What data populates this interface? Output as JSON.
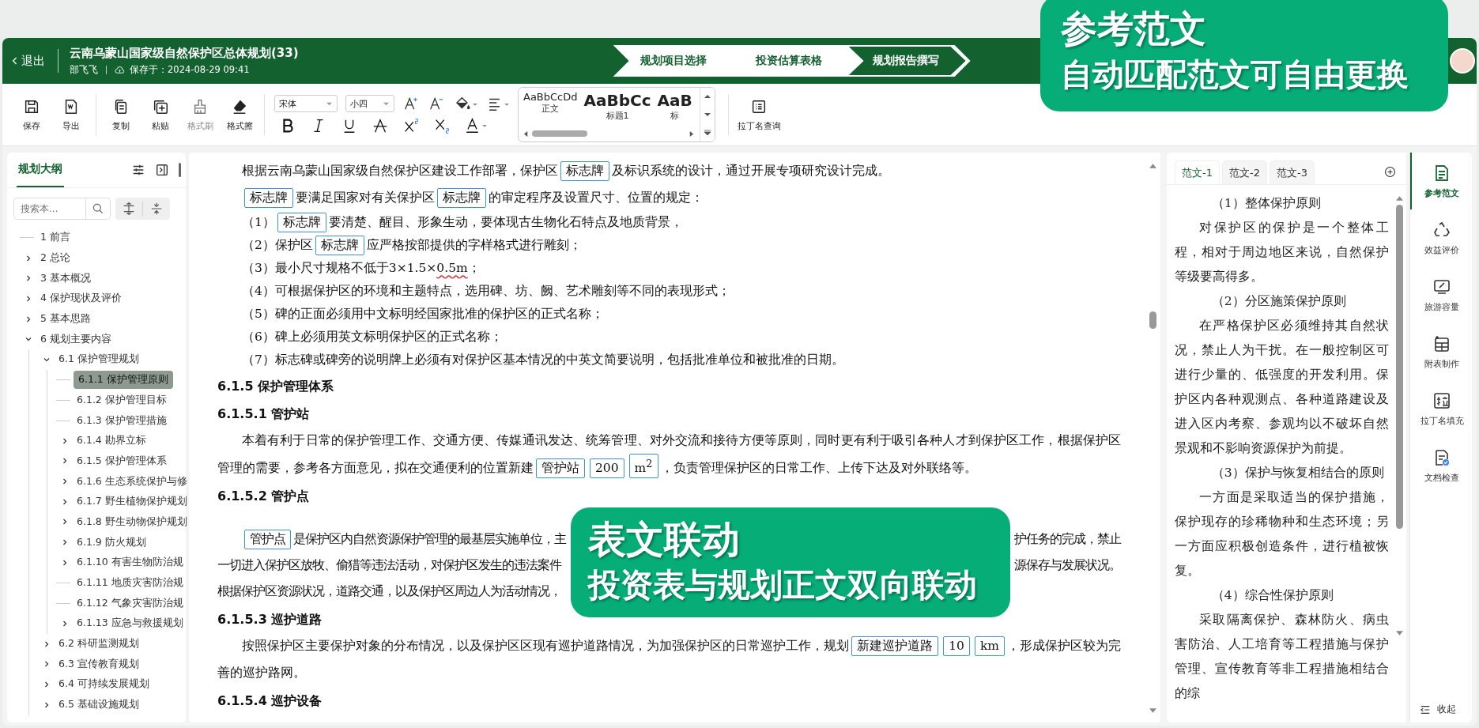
{
  "window": {
    "back_label": "退出",
    "title": "云南乌蒙山国家级自然保护区总体规划(33)",
    "author": "部飞飞",
    "saved": "保存于：2024-08-29 09:41"
  },
  "steps": [
    {
      "label": "规划项目选择",
      "selected": false
    },
    {
      "label": "投资估算表格",
      "selected": false
    },
    {
      "label": "规划报告撰写",
      "selected": true
    }
  ],
  "toolbar": {
    "buttons": [
      {
        "kind": "save",
        "label": "保存",
        "disabled": false
      },
      {
        "kind": "export",
        "label": "导出",
        "disabled": false
      },
      {
        "kind": "copy",
        "label": "复制",
        "disabled": false
      },
      {
        "kind": "paste",
        "label": "粘贴",
        "disabled": false
      },
      {
        "kind": "brush",
        "label": "格式刷",
        "disabled": true
      },
      {
        "kind": "eraser",
        "label": "格式擦",
        "disabled": false
      }
    ],
    "font": "宋体",
    "size": "小四",
    "styles": [
      {
        "kind": "normal",
        "sample": "AaBbCcDd",
        "label": "正文"
      },
      {
        "kind": "heading",
        "sample": "AaBbCc",
        "label": "标题1"
      },
      {
        "kind": "heading",
        "sample": "AaB",
        "label": "标"
      }
    ],
    "latin_lookup": "拉丁名查询"
  },
  "outline": {
    "tab": "规划大纲",
    "search": {
      "placeholder": "搜索本..."
    },
    "items": [
      {
        "kind": "leaf",
        "label": "1 前言",
        "selected": false
      },
      {
        "kind": "branch",
        "label": "2 总论",
        "expanded": false,
        "selected": false
      },
      {
        "kind": "branch",
        "label": "3 基本概况",
        "expanded": false,
        "selected": false
      },
      {
        "kind": "branch",
        "label": "4 保护现状及评价",
        "expanded": false,
        "selected": false
      },
      {
        "kind": "branch",
        "label": "5 基本思路",
        "expanded": false,
        "selected": false
      },
      {
        "kind": "branch",
        "label": "6 规划主要内容",
        "expanded": true,
        "selected": false,
        "children": [
          {
            "kind": "branch",
            "label": "6.1 保护管理规划",
            "expanded": true,
            "selected": false,
            "children": [
              {
                "kind": "leaf",
                "label": "6.1.1 保护管理原则",
                "selected": true
              },
              {
                "kind": "leaf",
                "label": "6.1.2 保护管理目标",
                "selected": false
              },
              {
                "kind": "leaf",
                "label": "6.1.3 保护管理措施",
                "selected": false
              },
              {
                "kind": "branch",
                "label": "6.1.4 勘界立标",
                "expanded": false,
                "selected": false
              },
              {
                "kind": "branch",
                "label": "6.1.5 保护管理体系",
                "expanded": false,
                "selected": false
              },
              {
                "kind": "branch",
                "label": "6.1.6 生态系统保护与修",
                "expanded": false,
                "selected": false
              },
              {
                "kind": "branch",
                "label": "6.1.7 野生植物保护规划",
                "expanded": false,
                "selected": false
              },
              {
                "kind": "branch",
                "label": "6.1.8 野生动物保护规划",
                "expanded": false,
                "selected": false
              },
              {
                "kind": "branch",
                "label": "6.1.9 防火规划",
                "expanded": false,
                "selected": false
              },
              {
                "kind": "branch",
                "label": "6.1.10 有害生物防治规",
                "expanded": false,
                "selected": false
              },
              {
                "kind": "leaf",
                "label": "6.1.11 地质灾害防治规",
                "selected": false
              },
              {
                "kind": "leaf",
                "label": "6.1.12 气象灾害防治规",
                "selected": false
              },
              {
                "kind": "branch",
                "label": "6.1.13 应急与救援规划",
                "expanded": false,
                "selected": false
              }
            ]
          },
          {
            "kind": "branch",
            "label": "6.2 科研监测规划",
            "expanded": false,
            "selected": false
          },
          {
            "kind": "branch",
            "label": "6.3 宣传教育规划",
            "expanded": false,
            "selected": false
          },
          {
            "kind": "branch",
            "label": "6.4 可持续发展规划",
            "expanded": false,
            "selected": false
          },
          {
            "kind": "branch",
            "label": "6.5 基础设施规划",
            "expanded": false,
            "selected": false
          }
        ]
      }
    ]
  },
  "document": {
    "blocks": [
      {
        "kind": "para",
        "segments": [
          {
            "kind": "text",
            "text": "根据云南乌蒙山国家级自然保护区建设工作部署，保护区"
          },
          {
            "kind": "field",
            "text": "标志牌"
          },
          {
            "kind": "text",
            "text": "及标识系统的设计，通过开展专项研究设计完成。"
          }
        ]
      },
      {
        "kind": "para",
        "segments": [
          {
            "kind": "field",
            "text": "标志牌"
          },
          {
            "kind": "text",
            "text": "要满足国家对有关保护区"
          },
          {
            "kind": "field",
            "text": "标志牌"
          },
          {
            "kind": "text",
            "text": "的审定程序及设置尺寸、位置的规定："
          }
        ]
      },
      {
        "kind": "item",
        "segments": [
          {
            "kind": "text",
            "text": "（1）"
          },
          {
            "kind": "field",
            "text": "标志牌"
          },
          {
            "kind": "text",
            "text": "要清楚、醒目、形象生动，要体现古生物化石特点及地质背景，"
          }
        ]
      },
      {
        "kind": "item",
        "segments": [
          {
            "kind": "text",
            "text": "（2）保护区"
          },
          {
            "kind": "field",
            "text": "标志牌"
          },
          {
            "kind": "text",
            "text": "应严格按部提供的字样格式进行雕刻；"
          }
        ]
      },
      {
        "kind": "item",
        "segments": [
          {
            "kind": "text",
            "text": "（3）最小尺寸规格不低于3×1.5×"
          },
          {
            "kind": "flagged",
            "text": "0.5m"
          },
          {
            "kind": "text",
            "text": "；"
          }
        ]
      },
      {
        "kind": "item",
        "segments": [
          {
            "kind": "text",
            "text": "（4）可根据保护区的环境和主题特点，选用碑、坊、阙、艺术雕刻等不同的表现形式；"
          }
        ]
      },
      {
        "kind": "item",
        "segments": [
          {
            "kind": "text",
            "text": "（5）碑的正面必须用中文标明经国家批准的保护区的正式名称；"
          }
        ]
      },
      {
        "kind": "item",
        "segments": [
          {
            "kind": "text",
            "text": "（6）碑上必须用英文标明保护区的正式名称；"
          }
        ]
      },
      {
        "kind": "item",
        "segments": [
          {
            "kind": "text",
            "text": "（7）标志碑或碑旁的说明牌上必须有对保护区基本情况的中英文简要说明，包括批准单位和被批准的日期。"
          }
        ]
      },
      {
        "kind": "heading",
        "text": "6.1.5 保护管理体系"
      },
      {
        "kind": "heading",
        "text": "6.1.5.1 管护站"
      },
      {
        "kind": "para",
        "segments": [
          {
            "kind": "text",
            "text": "本着有利于日常的保护管理工作、交通方便、传媒通讯发达、统筹管理、对外交流和接待方便等原则，同时更有利于吸引各种人才到保护区工作，根据保护区管理的需要，参考各方面意见，拟在交通便利的位置新建"
          },
          {
            "kind": "field",
            "text": "管护站"
          },
          {
            "kind": "field",
            "text": "200"
          },
          {
            "kind": "field",
            "text": "m$^{2}$"
          },
          {
            "kind": "text",
            "text": "，负责管理保护区的日常工作、上传下达及对外联络等。"
          }
        ]
      },
      {
        "kind": "heading",
        "text": "6.1.5.2 管护点"
      },
      {
        "kind": "covered",
        "lines": [
          {
            "segments": [
              {
                "kind": "field",
                "text": "管护点"
              },
              {
                "kind": "text",
                "text": "是保护区内自然资源保护管理的最基层实施单位，主"
              }
            ],
            "tail": "护任务的完成，禁止"
          },
          {
            "segments": [
              {
                "kind": "text",
                "text": "一切进入保护区放牧、偷猎等违法活动，对保护区发生的违法案件"
              }
            ],
            "tail": "源保存与发展状况。"
          },
          {
            "segments": [
              {
                "kind": "text",
                "text": "根据保护区资源状况，道路交通，以及保护区周边人为活动情况，"
              }
            ]
          }
        ]
      },
      {
        "kind": "heading",
        "text": "6.1.5.3 巡护道路"
      },
      {
        "kind": "para",
        "segments": [
          {
            "kind": "text",
            "text": "按照保护区主要保护对象的分布情况，以及保护区区现有巡护道路情况，为加强保护区的日常巡护工作，规划"
          },
          {
            "kind": "field",
            "text": "新建巡护道路"
          },
          {
            "kind": "field",
            "text": "10"
          },
          {
            "kind": "field",
            "text": "km"
          },
          {
            "kind": "text",
            "text": "，形成保护区较为完善的巡护路网。"
          }
        ]
      },
      {
        "kind": "heading",
        "text": "6.1.5.4 巡护设备"
      }
    ]
  },
  "samples": {
    "tabs": [
      {
        "label": "范文-1",
        "selected": true
      },
      {
        "label": "范文-2",
        "selected": false
      },
      {
        "label": "范文-3",
        "selected": false
      }
    ],
    "paragraphs": [
      {
        "kind": "heading",
        "text": "（1）整体保护原则"
      },
      {
        "kind": "body",
        "text": "对保护区的保护是一个整体工程，相对于周边地区来说，自然保护等级要高得多。"
      },
      {
        "kind": "heading",
        "text": "（2）分区施策保护原则"
      },
      {
        "kind": "body",
        "text": "在严格保护区必须维持其自然状况，禁止人为干扰。在一般控制区可进行少量的、低强度的开发利用。保护区内各种观测点、各种道路建设及进入区内考察、参观均以不破坏自然景观和不影响资源保护为前提。"
      },
      {
        "kind": "heading",
        "text": "（3）保护与恢复相结合的原则"
      },
      {
        "kind": "body",
        "text": "一方面是采取适当的保护措施，保护现存的珍稀物种和生态环境；另一方面应积极创造条件，进行植被恢复。"
      },
      {
        "kind": "heading",
        "text": "（4）综合性保护原则"
      },
      {
        "kind": "body",
        "text": "采取隔离保护、森林防火、病虫害防治、人工培育等工程措施与保护管理、宣传教育等非工程措施相结合的综"
      }
    ]
  },
  "rail": {
    "items": [
      {
        "kind": "document",
        "label": "参考范文",
        "selected": true
      },
      {
        "kind": "recycle",
        "label": "效益评价",
        "selected": false
      },
      {
        "kind": "monitor",
        "label": "旅游容量",
        "selected": false
      },
      {
        "kind": "table",
        "label": "附表制作",
        "selected": false
      },
      {
        "kind": "latin",
        "label": "拉丁名填充",
        "selected": false
      },
      {
        "kind": "check",
        "label": "文档检查",
        "selected": false
      }
    ],
    "collapse": "收起"
  },
  "callouts": [
    {
      "kind": "top",
      "title": "参考范文",
      "subtitle": "自动匹配范文可自由更换"
    },
    {
      "kind": "middle",
      "title": "表文联动",
      "subtitle": "投资表与规划正文双向联动"
    }
  ]
}
